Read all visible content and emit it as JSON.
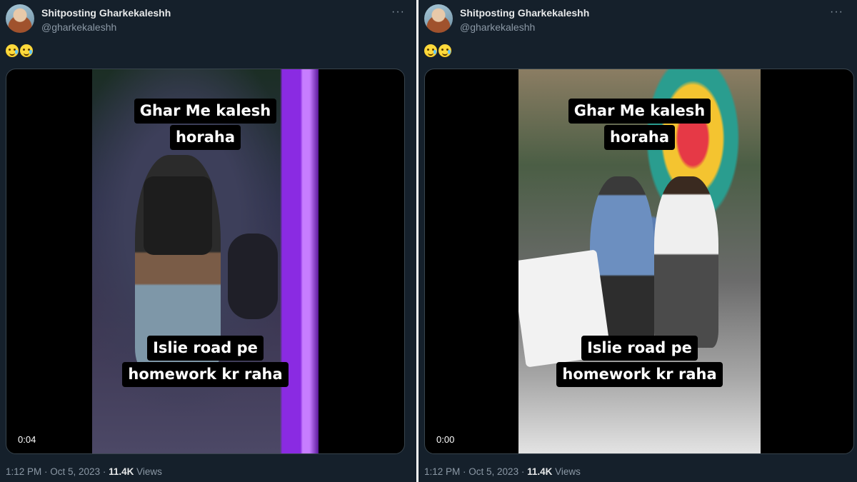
{
  "tweets": [
    {
      "author_name": "Shitposting Gharkekaleshh",
      "handle": "@gharkekaleshh",
      "more_label": "···",
      "emojis": [
        "drooling-face-emoji",
        "drooling-face-emoji"
      ],
      "video": {
        "caption_top": [
          "Ghar Me kalesh",
          "horaha"
        ],
        "caption_bottom": [
          "Islie road pe",
          "homework kr raha"
        ],
        "timestamp": "0:04"
      },
      "meta": {
        "time": "1:12 PM",
        "sep1": " · ",
        "date": "Oct 5, 2023",
        "sep2": " · ",
        "views_count": "11.4K",
        "views_label": " Views"
      }
    },
    {
      "author_name": "Shitposting Gharkekaleshh",
      "handle": "@gharkekaleshh",
      "more_label": "···",
      "emojis": [
        "drooling-face-emoji",
        "drooling-face-emoji"
      ],
      "video": {
        "caption_top": [
          "Ghar Me kalesh",
          "horaha"
        ],
        "caption_bottom": [
          "Islie road pe",
          "homework kr raha"
        ],
        "timestamp": "0:00"
      },
      "meta": {
        "time": "1:12 PM",
        "sep1": " · ",
        "date": "Oct 5, 2023",
        "sep2": " · ",
        "views_count": "11.4K",
        "views_label": " Views"
      }
    }
  ],
  "colors": {
    "background": "#15202b",
    "text": "#e7e9ea",
    "muted": "#8b98a5",
    "border": "#38444d"
  }
}
